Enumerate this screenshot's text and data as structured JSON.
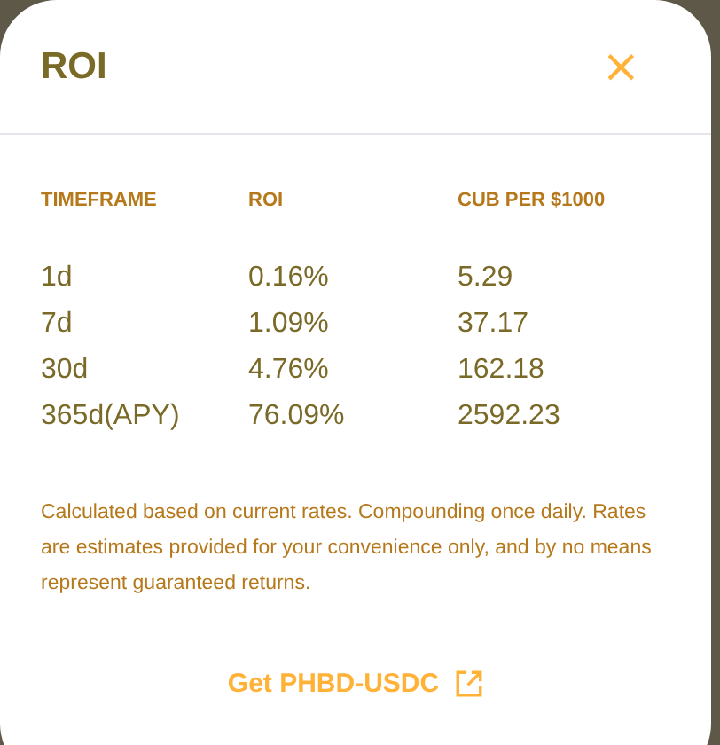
{
  "modal": {
    "title": "ROI",
    "close": "×"
  },
  "table": {
    "columns": [
      "TIMEFRAME",
      "ROI",
      "CUB PER $1000"
    ],
    "rows": [
      [
        "1d",
        "0.16%",
        "5.29"
      ],
      [
        "7d",
        "1.09%",
        "37.17"
      ],
      [
        "30d",
        "4.76%",
        "162.18"
      ],
      [
        "365d(APY)",
        "76.09%",
        "2592.23"
      ]
    ]
  },
  "note": "Calculated based on current rates. Compounding once daily. Rates are estimates provided for your convenience only, and by no means represent guaranteed returns.",
  "link": "Get PHBD-USDC"
}
